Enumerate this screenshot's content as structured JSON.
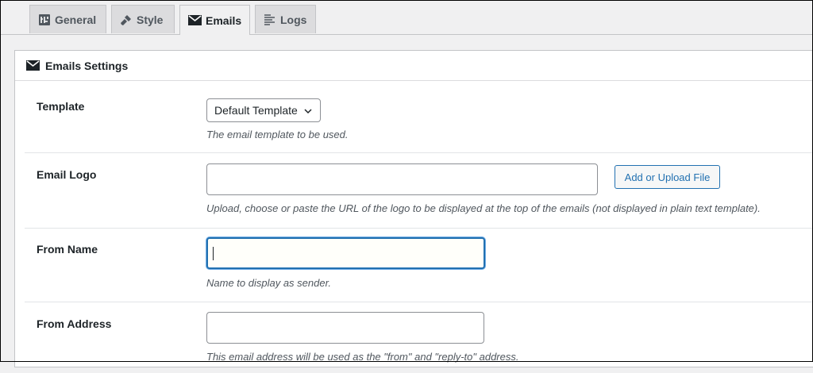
{
  "tabs": [
    {
      "label": "General",
      "icon": "general-settings-icon"
    },
    {
      "label": "Style",
      "icon": "paintbrush-icon"
    },
    {
      "label": "Emails",
      "icon": "envelope-icon",
      "active": true
    },
    {
      "label": "Logs",
      "icon": "list-lines-icon"
    }
  ],
  "panel": {
    "title": "Emails Settings",
    "icon": "envelope-icon"
  },
  "fields": {
    "template": {
      "label": "Template",
      "selected": "Default Template",
      "description": "The email template to be used."
    },
    "email_logo": {
      "label": "Email Logo",
      "value": "",
      "button_label": "Add or Upload File",
      "description": "Upload, choose or paste the URL of the logo to be displayed at the top of the emails (not displayed in plain text template)."
    },
    "from_name": {
      "label": "From Name",
      "value": "",
      "description": "Name to display as sender."
    },
    "from_address": {
      "label": "From Address",
      "value": "",
      "description": "This email address will be used as the \"from\" and \"reply-to\" address."
    }
  },
  "colors": {
    "accent": "#2271b1",
    "background": "#f0f0f1"
  }
}
